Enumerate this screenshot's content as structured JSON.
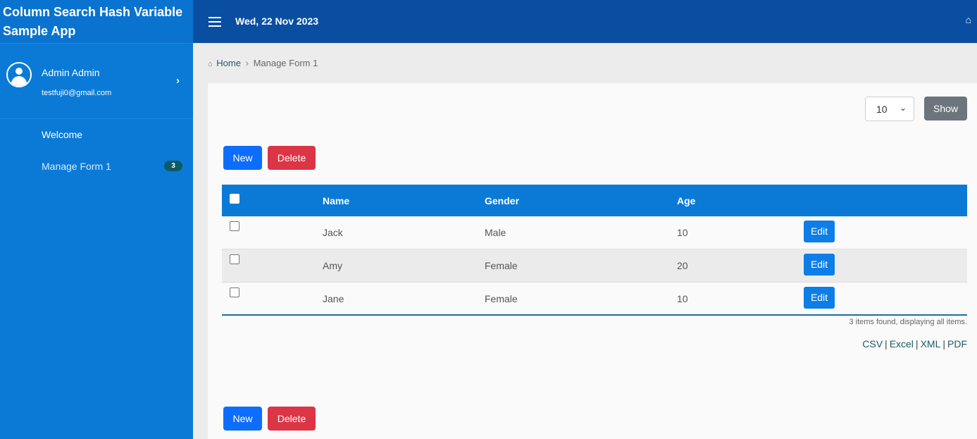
{
  "app": {
    "title_line1": "Column Search Hash Variable",
    "title_line2": "Sample App"
  },
  "user": {
    "name": "Admin Admin",
    "email": "testfuji0@gmail.com"
  },
  "nav": {
    "welcome": "Welcome",
    "manage_form": "Manage Form 1",
    "manage_form_badge": "3"
  },
  "topbar": {
    "date": "Wed, 22 Nov 2023"
  },
  "breadcrumb": {
    "home": "Home",
    "current": "Manage Form 1"
  },
  "toolbar": {
    "page_size": "10",
    "show_label": "Show",
    "new_label": "New",
    "delete_label": "Delete"
  },
  "table": {
    "headers": {
      "name": "Name",
      "gender": "Gender",
      "age": "Age"
    },
    "rows": [
      {
        "name": "Jack",
        "gender": "Male",
        "age": "10",
        "action": "Edit"
      },
      {
        "name": "Amy",
        "gender": "Female",
        "age": "20",
        "action": "Edit"
      },
      {
        "name": "Jane",
        "gender": "Female",
        "age": "10",
        "action": "Edit"
      }
    ],
    "summary": "3 items found, displaying all items."
  },
  "exports": {
    "csv": "CSV",
    "excel": "Excel",
    "xml": "XML",
    "pdf": "PDF",
    "separator": "|"
  },
  "colors": {
    "sidebar": "#0b7ad6",
    "topbar": "#0a4ea1",
    "primary": "#0d6efd",
    "danger": "#dc3545",
    "secondary": "#6c757d"
  },
  "icons": {
    "menu": "hamburger-icon",
    "home": "home-icon",
    "user": "user-avatar-icon",
    "chevron": "chevron-right-icon"
  }
}
